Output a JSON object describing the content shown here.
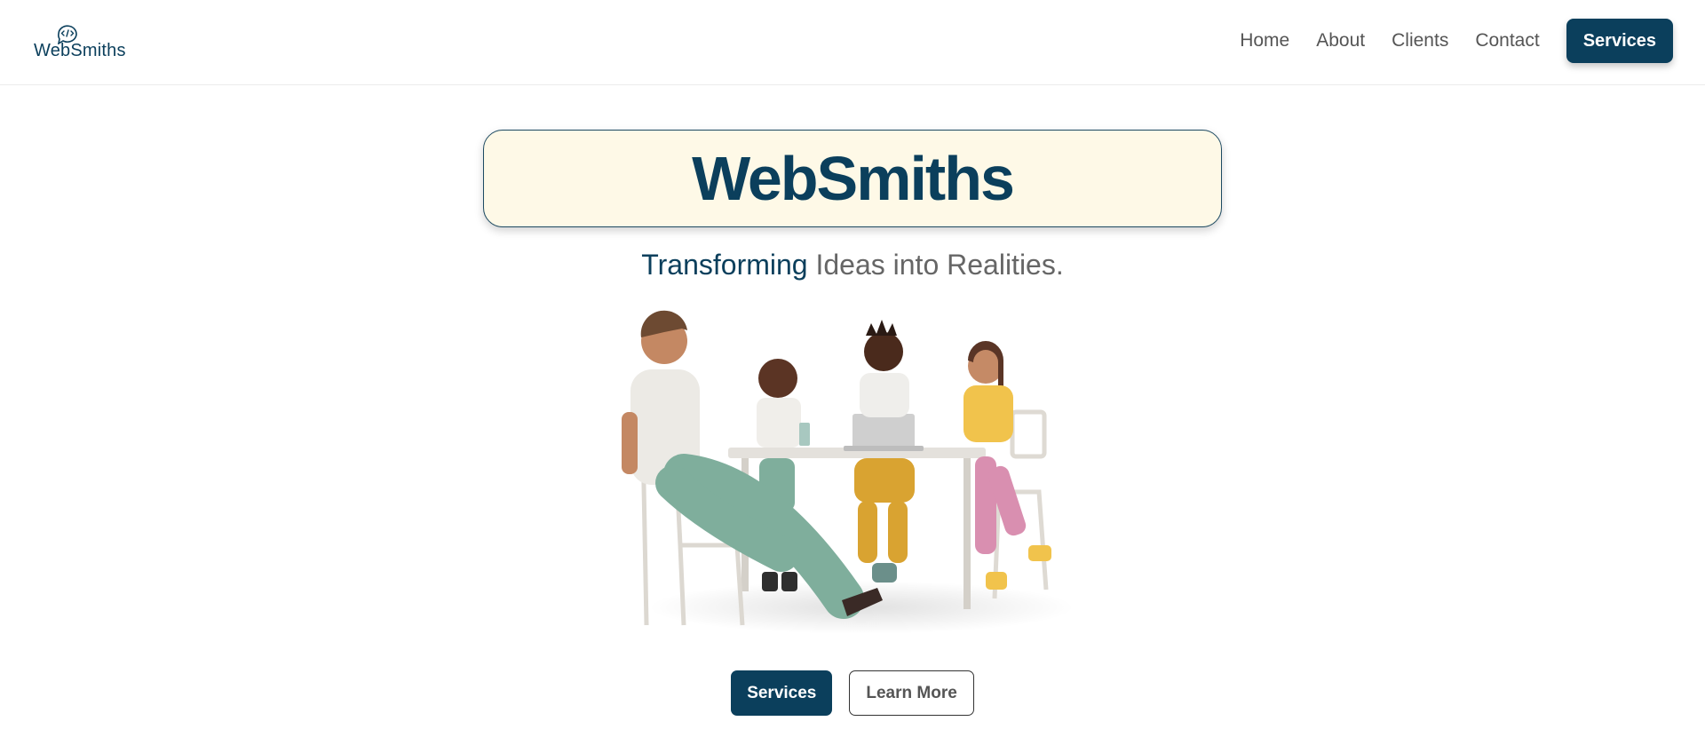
{
  "brand": {
    "logo_text": "WebSmiths",
    "logo_icon": "code-brackets-chat-icon"
  },
  "nav": {
    "links": [
      "Home",
      "About",
      "Clients",
      "Contact"
    ],
    "cta_label": "Services"
  },
  "hero": {
    "title": "WebSmiths",
    "tagline_accent": "Transforming",
    "tagline_rest": " Ideas into Realities.",
    "illustration": "team-at-table-illustration",
    "primary_button": "Services",
    "secondary_button": "Learn More"
  },
  "colors": {
    "brand": "#0b3f5c",
    "title_box_bg": "#fef9e7",
    "text_muted": "#555555"
  }
}
